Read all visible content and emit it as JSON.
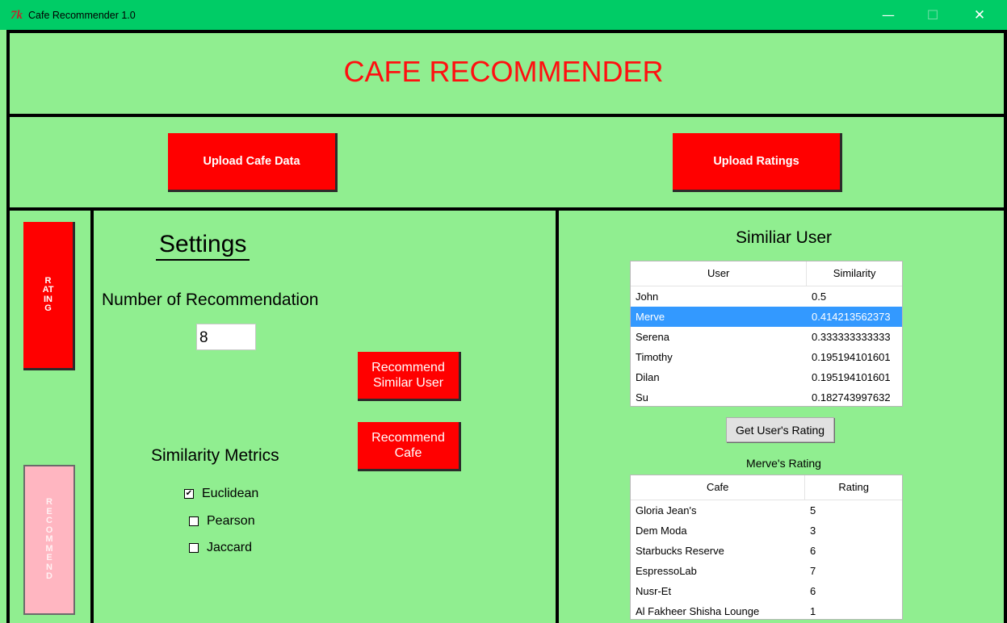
{
  "window": {
    "icon_text": "7k",
    "title": "Cafe Recommender 1.0",
    "minimize": "—",
    "maximize": "☐",
    "close": "✕"
  },
  "app": {
    "title": "CAFE RECOMMENDER"
  },
  "toolbar": {
    "upload_cafe_label": "Upload Cafe Data",
    "upload_ratings_label": "Upload Ratings"
  },
  "tabs": {
    "rating_label": "RATING",
    "recommend_label": "RECOMMEND"
  },
  "settings": {
    "title": "Settings",
    "num_rec_label": "Number of Recommendation",
    "num_rec_value": "8",
    "rec_similar_user_label": "Recommend Similar User",
    "rec_cafe_label": "Recommend Cafe",
    "similarity_label": "Similarity Metrics",
    "metrics": [
      {
        "label": "Euclidean",
        "checked": true,
        "mark": "✔"
      },
      {
        "label": "Pearson",
        "checked": false,
        "mark": ""
      },
      {
        "label": "Jaccard",
        "checked": false,
        "mark": ""
      }
    ]
  },
  "similar_users": {
    "title": "Similiar User",
    "columns": [
      "User",
      "Similarity"
    ],
    "rows": [
      {
        "user": "John",
        "similarity": "0.5",
        "selected": false
      },
      {
        "user": "Merve",
        "similarity": "0.414213562373",
        "selected": true
      },
      {
        "user": "Serena",
        "similarity": "0.333333333333",
        "selected": false
      },
      {
        "user": "Timothy",
        "similarity": "0.195194101601",
        "selected": false
      },
      {
        "user": "Dilan",
        "similarity": "0.195194101601",
        "selected": false
      },
      {
        "user": "Su",
        "similarity": "0.182743997632",
        "selected": false
      }
    ],
    "get_rating_label": "Get User's Rating"
  },
  "user_ratings": {
    "title": "Merve's Rating",
    "columns": [
      "Cafe",
      "Rating"
    ],
    "rows": [
      {
        "cafe": "Gloria Jean's",
        "rating": "5"
      },
      {
        "cafe": "Dem Moda",
        "rating": "3"
      },
      {
        "cafe": "Starbucks Reserve",
        "rating": "6"
      },
      {
        "cafe": "EspressoLab",
        "rating": "7"
      },
      {
        "cafe": "Nusr-Et",
        "rating": "6"
      },
      {
        "cafe": "Al Fakheer Shisha Lounge",
        "rating": "1"
      }
    ]
  },
  "colors": {
    "background": "#90ee90",
    "titlebar": "#00cc66",
    "accent_red": "#ff0000",
    "disabled_pink": "#ffb6c1",
    "selection": "#3399ff"
  }
}
